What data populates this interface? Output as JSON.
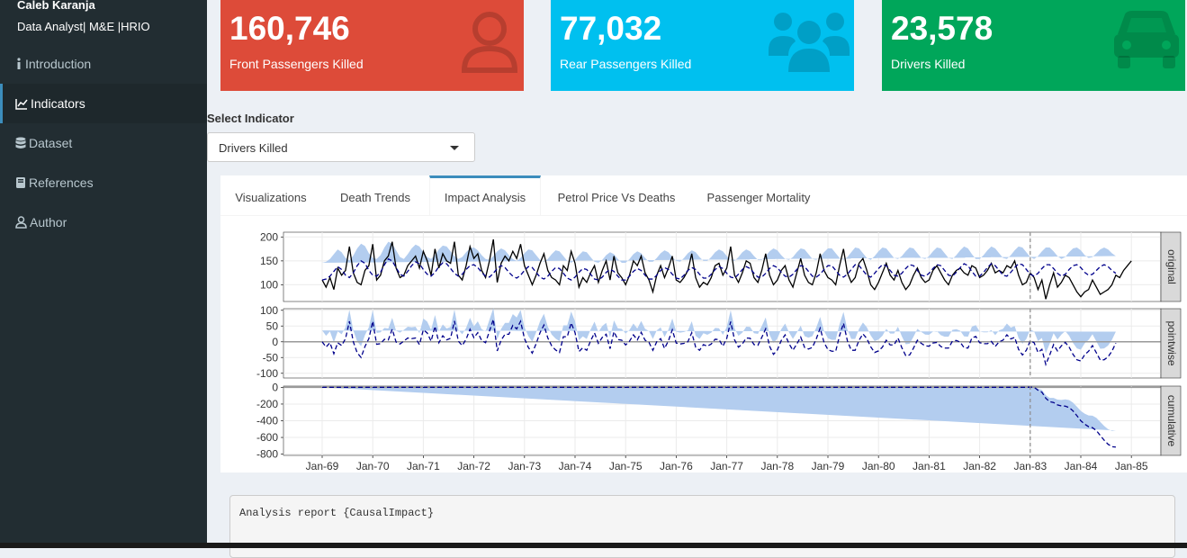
{
  "sidebar": {
    "user_name": "Caleb Karanja",
    "user_role": "Data Analyst| M&E |HRIO",
    "items": [
      {
        "label": "Introduction",
        "icon": "info-icon"
      },
      {
        "label": "Indicators",
        "icon": "line-chart-icon",
        "active": true
      },
      {
        "label": "Dataset",
        "icon": "database-icon"
      },
      {
        "label": "References",
        "icon": "book-icon"
      },
      {
        "label": "Author",
        "icon": "user-icon"
      }
    ]
  },
  "value_boxes": [
    {
      "value": "160,746",
      "label": "Front Passengers Killed",
      "color": "#dd4b39",
      "icon": "user-icon"
    },
    {
      "value": "77,032",
      "label": "Rear Passengers Killed",
      "color": "#00c0ef",
      "icon": "users-icon"
    },
    {
      "value": "23,578",
      "label": "Drivers Killed",
      "color": "#00a65a",
      "icon": "car-icon"
    }
  ],
  "select": {
    "label": "Select Indicator",
    "value": "Drivers Killed"
  },
  "tabs": [
    {
      "label": "Visualizations"
    },
    {
      "label": "Death Trends"
    },
    {
      "label": "Impact Analysis",
      "active": true
    },
    {
      "label": "Petrol Price Vs Deaths"
    },
    {
      "label": "Passenger Mortality"
    }
  ],
  "report": {
    "text": "Analysis report {CausalImpact}"
  },
  "chart_data": {
    "type": "line",
    "x_tick_labels": [
      "Jan-69",
      "Jan-70",
      "Jan-71",
      "Jan-72",
      "Jan-73",
      "Jan-74",
      "Jan-75",
      "Jan-76",
      "Jan-77",
      "Jan-78",
      "Jan-79",
      "Jan-80",
      "Jan-81",
      "Jan-82",
      "Jan-83",
      "Jan-84",
      "Jan-85"
    ],
    "intervention": "Jan-83",
    "grid": true,
    "colors": {
      "observed": "#000000",
      "prediction": "#00008b",
      "band": "#b3cdef",
      "intervention": "#8c8c8c",
      "strip": "#d9d9d9"
    },
    "panels": [
      {
        "name": "original",
        "yticks": [
          100,
          150,
          200
        ],
        "ylim": [
          65,
          210
        ],
        "series": [
          {
            "name": "observed",
            "values": [
              110,
              95,
              115,
              90,
              135,
              120,
              130,
              180,
              125,
              105,
              100,
              130,
              140,
              185,
              110,
              120,
              150,
              160,
              190,
              135,
              115,
              120,
              140,
              150,
              160,
              135,
              170,
              150,
              120,
              175,
              135,
              165,
              150,
              145,
              190,
              120,
              110,
              140,
              180,
              155,
              165,
              130,
              115,
              150,
              195,
              105,
              145,
              160,
              150,
              170,
              155,
              185,
              140,
              120,
              100,
              120,
              145,
              165,
              130,
              115,
              110,
              100,
              140,
              130,
              170,
              145,
              95,
              115,
              105,
              125,
              140,
              105,
              130,
              150,
              110,
              160,
              125,
              115,
              100,
              120,
              150,
              140,
              160,
              125,
              110,
              85,
              120,
              140,
              115,
              135,
              160,
              110,
              105,
              115,
              130,
              165,
              115,
              95,
              105,
              100,
              115,
              140,
              145,
              120,
              135,
              180,
              120,
              105,
              125,
              150,
              145,
              115,
              105,
              130,
              165,
              120,
              100,
              110,
              130,
              140,
              110,
              95,
              125,
              155,
              120,
              105,
              100,
              125,
              165,
              130,
              115,
              110,
              100,
              140,
              175,
              125,
              105,
              115,
              145,
              155,
              130,
              100,
              90,
              105,
              125,
              145,
              120,
              110,
              130,
              105,
              90,
              100,
              120,
              135,
              115,
              105,
              110,
              130,
              140,
              125,
              110,
              100,
              120,
              130,
              135,
              125,
              120,
              140,
              135,
              115,
              120,
              130,
              145,
              125,
              130,
              125,
              140,
              135,
              150,
              120,
              100,
              105,
              125,
              115,
              90,
              110,
              70,
              100,
              125,
              95,
              105,
              120,
              115,
              100,
              85,
              75,
              85,
              90,
              110,
              95,
              80,
              85,
              90,
              100,
              120,
              115,
              130,
              140,
              150
            ]
          },
          {
            "name": "prediction",
            "values": [
              110,
              112,
              118,
              128,
              138,
              132,
              120,
              115,
              125,
              140,
              150,
              145,
              130,
              120,
              118,
              126,
              142,
              154,
              150,
              136,
              122,
              118,
              128,
              140,
              148,
              144,
              132,
              122,
              118,
              126,
              138,
              146,
              144,
              134,
              124,
              118,
              122,
              132,
              140,
              142,
              136,
              126,
              118,
              116,
              124,
              134,
              140,
              136,
              126,
              118,
              114,
              120,
              130,
              138,
              136,
              126,
              116,
              112,
              118,
              128,
              136,
              134,
              124,
              114,
              110,
              116,
              126,
              134,
              132,
              122,
              112,
              110,
              116,
              126,
              132,
              128,
              118,
              110,
              110,
              118,
              128,
              134,
              130,
              120,
              112,
              112,
              120,
              130,
              136,
              132,
              122,
              114,
              112,
              120,
              130,
              136,
              132,
              122,
              114,
              114,
              122,
              132,
              138,
              134,
              124,
              116,
              114,
              122,
              132,
              138,
              134,
              124,
              116,
              116,
              124,
              134,
              140,
              136,
              126,
              118,
              116,
              122,
              132,
              140,
              138,
              128,
              118,
              116,
              122,
              132,
              140,
              140,
              130,
              120,
              116,
              122,
              132,
              142,
              140,
              130,
              120,
              116,
              124,
              134,
              142,
              140,
              130,
              120,
              118,
              124,
              134,
              142,
              140,
              130,
              120,
              118,
              124,
              134,
              142,
              140,
              130,
              120,
              118,
              126,
              136,
              144,
              140,
              128,
              118,
              118,
              126,
              136,
              144,
              140,
              130,
              120,
              118,
              126,
              136,
              144,
              142,
              132,
              122,
              118,
              124,
              134,
              142,
              142,
              134,
              124,
              118,
              122,
              132,
              140,
              142,
              136,
              126,
              120,
              122,
              130,
              138,
              142,
              138,
              130,
              124
            ]
          }
        ]
      },
      {
        "name": "pointwise",
        "yticks": [
          -100,
          -50,
          0,
          50,
          100
        ],
        "ylim": [
          -115,
          105
        ]
      },
      {
        "name": "cumulative",
        "yticks": [
          -800,
          -600,
          -400,
          -200,
          0
        ],
        "ylim": [
          -815,
          15
        ]
      }
    ]
  }
}
